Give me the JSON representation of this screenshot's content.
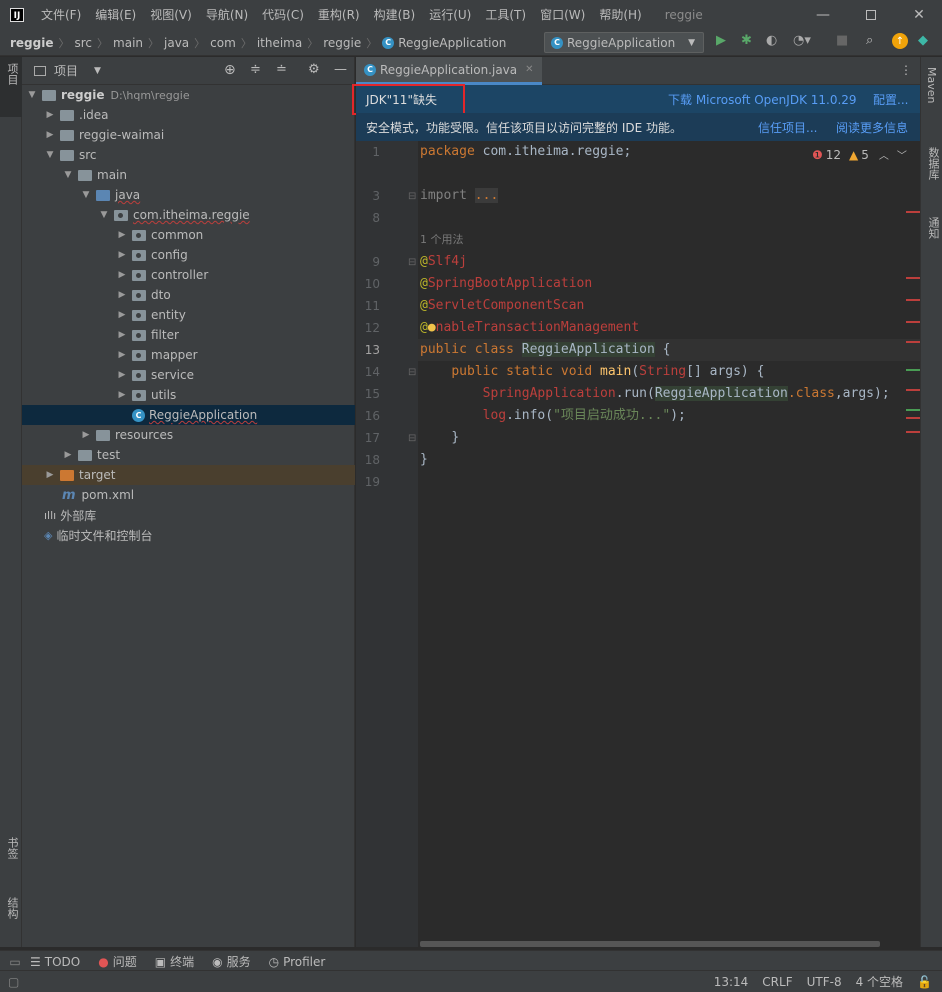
{
  "menu": [
    "文件(F)",
    "编辑(E)",
    "视图(V)",
    "导航(N)",
    "代码(C)",
    "重构(R)",
    "构建(B)",
    "运行(U)",
    "工具(T)",
    "窗口(W)",
    "帮助(H)"
  ],
  "window_title": "reggie",
  "breadcrumbs": [
    "reggie",
    "src",
    "main",
    "java",
    "com",
    "itheima",
    "reggie",
    "ReggieApplication"
  ],
  "run_config": "ReggieApplication",
  "left_strip": {
    "project": "项目",
    "bookmarks": "书签",
    "structure": "结构"
  },
  "right_strip": {
    "maven": "Maven",
    "database": "数据库",
    "notifications": "通知"
  },
  "project_panel": {
    "title": "项目"
  },
  "tree": [
    {
      "label": "reggie",
      "path": "D:\\hqm\\reggie"
    },
    {
      "label": ".idea"
    },
    {
      "label": "reggie-waimai"
    },
    {
      "label": "src"
    },
    {
      "label": "main"
    },
    {
      "label": "java"
    },
    {
      "label": "com.itheima.reggie"
    },
    {
      "label": "common"
    },
    {
      "label": "config"
    },
    {
      "label": "controller"
    },
    {
      "label": "dto"
    },
    {
      "label": "entity"
    },
    {
      "label": "filter"
    },
    {
      "label": "mapper"
    },
    {
      "label": "service"
    },
    {
      "label": "utils"
    },
    {
      "label": "ReggieApplication"
    },
    {
      "label": "resources"
    },
    {
      "label": "test"
    },
    {
      "label": "target"
    },
    {
      "label": "pom.xml"
    },
    {
      "label": "外部库"
    },
    {
      "label": "临时文件和控制台"
    }
  ],
  "editor_tab": "ReggieApplication.java",
  "banner1": {
    "message": "JDK\"11\"缺失",
    "download": "下载 Microsoft OpenJDK 11.0.29",
    "configure": "配置..."
  },
  "banner2": {
    "message": "安全模式，功能受限。信任该项目以访问完整的 IDE 功能。",
    "trust": "信任项目...",
    "learn_more": "阅读更多信息"
  },
  "inspections": {
    "errors": "12",
    "warnings": "5"
  },
  "line_numbers": [
    "1",
    "3",
    "8",
    "9",
    "10",
    "11",
    "12",
    "13",
    "14",
    "15",
    "16",
    "17",
    "18",
    "19"
  ],
  "code": {
    "l1_kw": "package",
    "l1_rest": " com.itheima.reggie;",
    "l3_kw": "import",
    "l3_fold": "...",
    "usage_hint": "1 个用法",
    "l9_at": "@",
    "l9_name": "Slf4j",
    "l10_at": "@",
    "l10_name": "SpringBootApplication",
    "l11_at": "@",
    "l11_name": "ServletComponentScan",
    "l12_at": "@",
    "l12_name": "nableTransactionManagement",
    "l13_kw": "public class ",
    "l13_cls": "ReggieApplication",
    "l13_rest": " {",
    "l14_kw": "public static void ",
    "l14_fn": "main",
    "l14_p1": "(",
    "l14_type": "String",
    "l14_rest": "[] args) {",
    "l15_cls": "SpringApplication",
    "l15_run": ".run(",
    "l15_arg": "ReggieApplication",
    "l15_kw": ".class",
    "l15_rest": ",args);",
    "l16_log": "log",
    "l16_info": ".info(",
    "l16_str": "\"项目启动成功...\"",
    "l16_rest": ");",
    "l17": "}",
    "l18": "}"
  },
  "bottom_tools": [
    "TODO",
    "问题",
    "终端",
    "服务",
    "Profiler"
  ],
  "status": {
    "position": "13:14",
    "line_sep": "CRLF",
    "encoding": "UTF-8",
    "indent": "4 个空格"
  }
}
